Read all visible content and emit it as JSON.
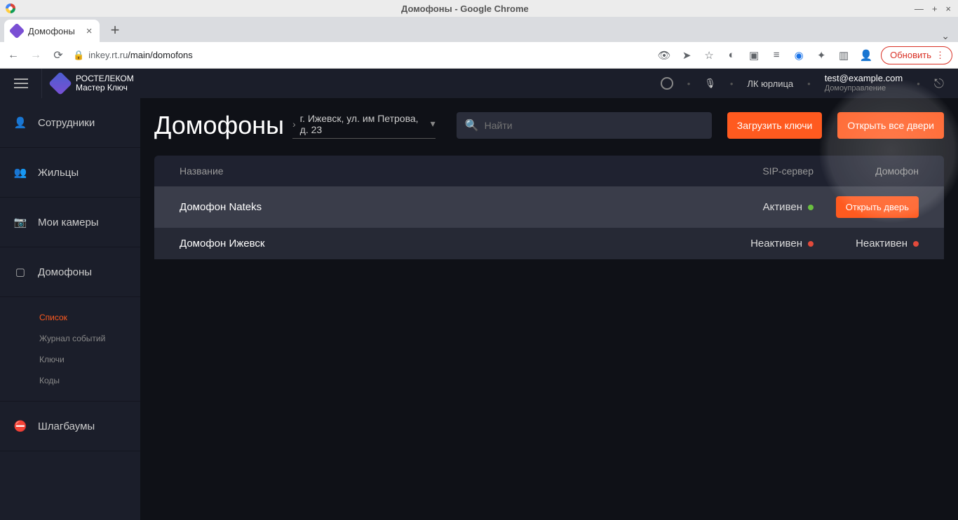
{
  "os": {
    "title": "Домофоны - Google Chrome"
  },
  "browser": {
    "tab_title": "Домофоны",
    "url_host": "inkey.rt.ru",
    "url_path": "/main/domofons",
    "update_label": "Обновить"
  },
  "header": {
    "brand_line1": "РОСТЕЛЕКОМ",
    "brand_line2": "Мастер Ключ",
    "account_switch": "ЛК юрлица",
    "user_email": "test@example.com",
    "user_role": "Домоуправление"
  },
  "sidebar": {
    "items": [
      {
        "label": "Сотрудники"
      },
      {
        "label": "Жильцы"
      },
      {
        "label": "Мои камеры"
      },
      {
        "label": "Домофоны"
      },
      {
        "label": "Шлагбаумы"
      }
    ],
    "submenu": [
      {
        "label": "Список",
        "active": true
      },
      {
        "label": "Журнал событий"
      },
      {
        "label": "Ключи"
      },
      {
        "label": "Коды"
      }
    ]
  },
  "page": {
    "title": "Домофоны",
    "breadcrumb": "г. Ижевск, ул. им Петрова, д. 23",
    "search_placeholder": "Найти",
    "btn_upload": "Загрузить ключи",
    "btn_open_all": "Открыть все двери"
  },
  "table": {
    "columns": {
      "name": "Название",
      "sip": "SIP-сервер",
      "domofon": "Домофон"
    },
    "rows": [
      {
        "name": "Домофон Nateks",
        "sip_status": "Активен",
        "sip_color": "green",
        "action_label": "Открыть дверь",
        "domofon_status": "",
        "domofon_color": ""
      },
      {
        "name": "Домофон Ижевск",
        "sip_status": "Неактивен",
        "sip_color": "red",
        "action_label": "",
        "domofon_status": "Неактивен",
        "domofon_color": "red"
      }
    ]
  }
}
